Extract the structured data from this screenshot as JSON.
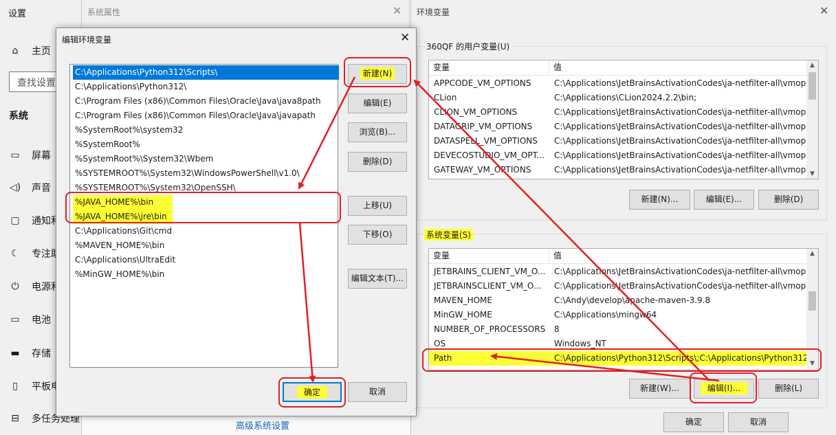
{
  "settings": {
    "title": "设置",
    "home": "主页",
    "search_placeholder": "查找设置",
    "section": "系统",
    "items": [
      {
        "icon": "monitor-icon",
        "glyph": "▭",
        "label": "屏幕"
      },
      {
        "icon": "speaker-icon",
        "glyph": "◁)",
        "label": "声音"
      },
      {
        "icon": "notification-icon",
        "glyph": "▢",
        "label": "通知和"
      },
      {
        "icon": "moon-icon",
        "glyph": "☾",
        "label": "专注助"
      },
      {
        "icon": "power-icon",
        "glyph": "⏻",
        "label": "电源和"
      },
      {
        "icon": "battery-icon",
        "glyph": "▭",
        "label": "电池"
      },
      {
        "icon": "storage-icon",
        "glyph": "▬",
        "label": "存储"
      },
      {
        "icon": "tablet-icon",
        "glyph": "▯",
        "label": "平板电"
      },
      {
        "icon": "multitask-icon",
        "glyph": "⊟",
        "label": "多任务处理"
      }
    ]
  },
  "system_properties": {
    "title": "系统属性",
    "advanced_link": "高级系统设置"
  },
  "env_dialog": {
    "title": "环境变量",
    "user_group_label": "360QF 的用户变量(U)",
    "col_var": "变量",
    "col_value": "值",
    "user_vars": [
      {
        "name": "APPCODE_VM_OPTIONS",
        "value": "C:\\Applications\\JetBrainsActivationCodes\\ja-netfilter-all\\vmop..."
      },
      {
        "name": "CLion",
        "value": "C:\\Applications\\CLion2024.2.2\\bin;"
      },
      {
        "name": "CLION_VM_OPTIONS",
        "value": "C:\\Applications\\JetBrainsActivationCodes\\ja-netfilter-all\\vmop..."
      },
      {
        "name": "DATAGRIP_VM_OPTIONS",
        "value": "C:\\Applications\\JetBrainsActivationCodes\\ja-netfilter-all\\vmop..."
      },
      {
        "name": "DATASPELL_VM_OPTIONS",
        "value": "C:\\Applications\\JetBrainsActivationCodes\\ja-netfilter-all\\vmop..."
      },
      {
        "name": "DEVECOSTUDIO_VM_OPT...",
        "value": "C:\\Applications\\JetBrainsActivationCodes\\ja-netfilter-all\\vmop..."
      },
      {
        "name": "GATEWAY_VM_OPTIONS",
        "value": "C:\\Applications\\JetBrainsActivationCodes\\ja-netfilter-all\\vmop..."
      }
    ],
    "user_buttons": {
      "new": "新建(N)...",
      "edit": "编辑(E)...",
      "delete": "删除(D)"
    },
    "system_group_label": "系统变量(S)",
    "system_vars": [
      {
        "name": "JETBRAINS_CLIENT_VM_O...",
        "value": "C:\\Applications\\JetBrainsActivationCodes\\ja-netfilter-all\\vmop..."
      },
      {
        "name": "JETBRAINSCLIENT_VM_O...",
        "value": "C:\\Applications\\JetBrainsActivationCodes\\ja-netfilter-all\\vmop..."
      },
      {
        "name": "MAVEN_HOME",
        "value": "C:\\Andy\\develop\\apache-maven-3.9.8"
      },
      {
        "name": "MinGW_HOME",
        "value": "C:\\Applications\\mingw64"
      },
      {
        "name": "NUMBER_OF_PROCESSORS",
        "value": "8"
      },
      {
        "name": "OS",
        "value": "Windows_NT"
      },
      {
        "name": "Path",
        "value": "C:\\Applications\\Python312\\Scripts\\;C:\\Applications\\Python312..."
      }
    ],
    "system_buttons": {
      "new": "新建(W)...",
      "edit": "编辑(I)...",
      "delete": "删除(L)"
    },
    "ok": "确定",
    "cancel": "取消"
  },
  "edit_dialog": {
    "title": "编辑环境变量",
    "items": [
      "C:\\Applications\\Python312\\Scripts\\",
      "C:\\Applications\\Python312\\",
      "C:\\Program Files (x86)\\Common Files\\Oracle\\Java\\java8path",
      "C:\\Program Files (x86)\\Common Files\\Oracle\\Java\\javapath",
      "%SystemRoot%\\system32",
      "%SystemRoot%",
      "%SystemRoot%\\System32\\Wbem",
      "%SYSTEMROOT%\\System32\\WindowsPowerShell\\v1.0\\",
      "%SYSTEMROOT%\\System32\\OpenSSH\\",
      "%JAVA_HOME%\\bin",
      "%JAVA_HOME%\\jre\\bin",
      "C:\\Applications\\Git\\cmd",
      "%MAVEN_HOME%\\bin",
      "C:\\Applications\\UltraEdit",
      "%MinGW_HOME%\\bin"
    ],
    "buttons": {
      "new": "新建(N)",
      "edit": "编辑(E)",
      "browse": "浏览(B)...",
      "delete": "删除(D)",
      "move_up": "上移(U)",
      "move_down": "下移(O)",
      "edit_text": "编辑文本(T)..."
    },
    "ok": "确定",
    "cancel": "取消"
  },
  "colors": {
    "annotation_red": "#e31e24",
    "highlight_yellow": "#ffff35",
    "selection_blue": "#0078d7"
  }
}
